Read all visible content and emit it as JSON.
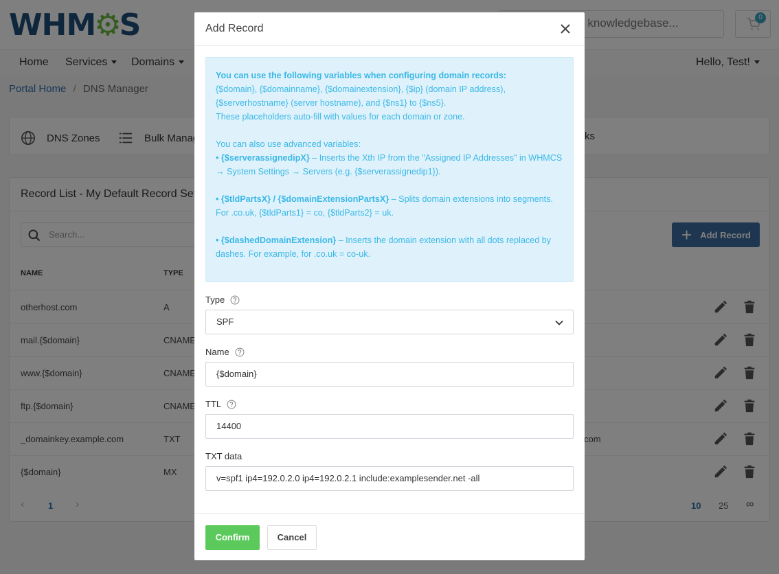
{
  "header": {
    "logo_text_left": "WHM",
    "logo_text_right": "S",
    "search_placeholder_visible": "r knowledgebase...",
    "cart_count": "0"
  },
  "navbar": {
    "home": "Home",
    "services": "Services",
    "domains": "Domains",
    "greeting": "Hello, Test!"
  },
  "breadcrumb": {
    "portal_home": "Portal Home",
    "separator": "/",
    "current": "DNS Manager"
  },
  "dns_nav": {
    "zones": "DNS Zones",
    "bulk": "Bulk Manag",
    "tasks_partial": "ks"
  },
  "card": {
    "title": "Record List - My Default Record Set",
    "search_placeholder": "Search...",
    "add_record": "Add Record",
    "columns": [
      "Name",
      "Type"
    ],
    "rows": [
      {
        "name": "otherhost.com",
        "type": "A",
        "value": ""
      },
      {
        "name": "mail.{$domain}",
        "type": "CNAME",
        "value": ""
      },
      {
        "name": "www.{$domain}",
        "type": "CNAME",
        "value": ""
      },
      {
        "name": "ftp.{$domain}",
        "type": "CNAME",
        "value": ""
      },
      {
        "name": "_domainkey.example.com",
        "type": "TXT",
        "value": "com"
      },
      {
        "name": "{$domain}",
        "type": "MX",
        "value": ""
      }
    ],
    "pager": {
      "page": "1",
      "sizes": [
        "10",
        "25",
        "∞"
      ]
    }
  },
  "modal": {
    "title": "Add Record",
    "info": {
      "line1": "You can use the following variables when configuring domain records:",
      "line2": "{$domain}, {$domainname}, {$domainextension}, {$ip} (domain IP address),",
      "line3": "{$serverhostname} (server hostname), and {$ns1} to {$ns5}.",
      "line4": "These placeholders auto-fill with values for each domain or zone.",
      "line5": "You can also use advanced variables:",
      "adv1_name": "• {$serverassignedipX}",
      "adv1_text": " – Inserts the Xth IP from the \"Assigned IP Addresses\" in WHMCS",
      "adv1_text2": "→ System Settings → Servers (e.g. {$serverassignedip1}).",
      "adv2_name": "• {$tldPartsX} / {$domainExtensionPartsX}",
      "adv2_text": " – Splits domain extensions into segments.",
      "adv2_text2": "For .co.uk, {$tldParts1} = co, {$tldParts2} = uk.",
      "adv3_name": "• {$dashedDomainExtension}",
      "adv3_text": " – Inserts the domain extension with all dots replaced by",
      "adv3_text2": "dashes. For example, for .co.uk = co-uk."
    },
    "type_label": "Type",
    "type_value": "SPF",
    "name_label": "Name",
    "name_value": "{$domain}",
    "ttl_label": "TTL",
    "ttl_value": "14400",
    "txt_label": "TXT data",
    "txt_value": "v=spf1 ip4=192.0.2.0 ip4=192.0.2.1 include:examplesender.net -all",
    "confirm": "Confirm",
    "cancel": "Cancel"
  },
  "colors": {
    "brand_blue": "#1f4e79",
    "brand_green": "#6bb83f",
    "primary_button": "#3f6ca0",
    "confirm_green": "#5cc95c",
    "info_bg": "#dff2fb",
    "info_text": "#3bb8e7"
  },
  "icons": [
    "gear-icon",
    "cart-icon",
    "globe-icon",
    "list-icon",
    "search-icon",
    "plus-icon",
    "pencil-icon",
    "trash-icon",
    "close-icon",
    "help-circle-icon",
    "chevron-down-icon"
  ]
}
